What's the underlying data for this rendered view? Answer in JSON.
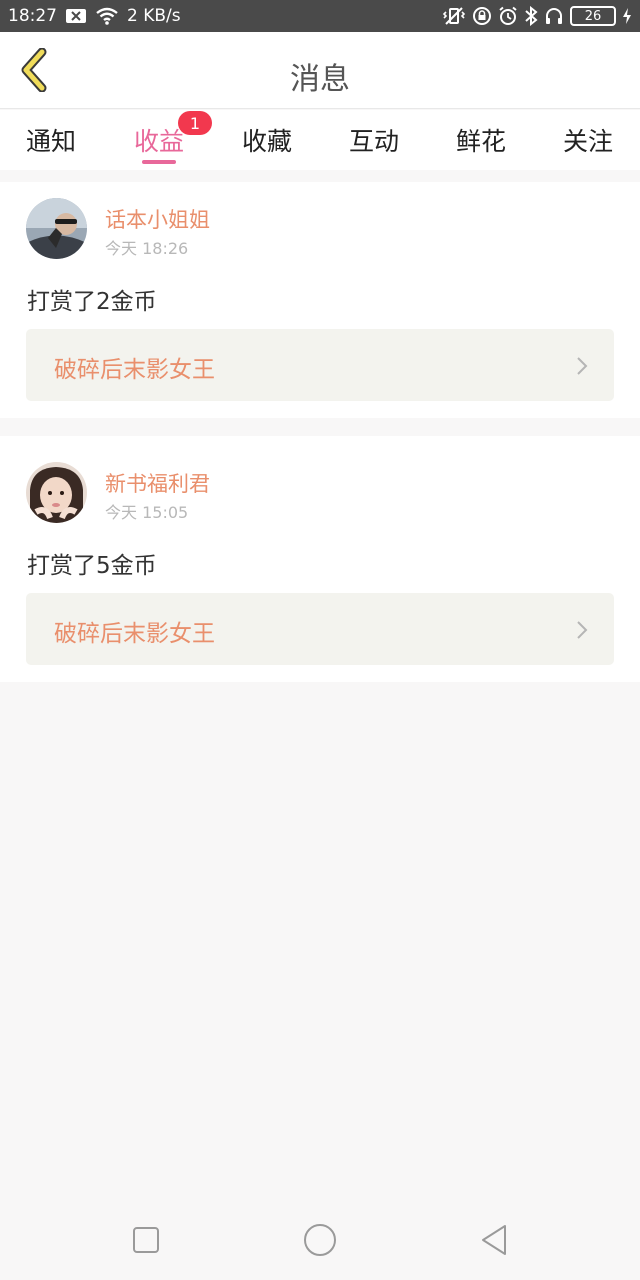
{
  "status_bar": {
    "time": "18:27",
    "network_speed": "2 KB/s",
    "battery_level": "26",
    "icons": [
      "notification-x-icon",
      "wifi-icon",
      "vibrate-icon",
      "lock-rotation-icon",
      "alarm-icon",
      "bluetooth-icon",
      "headphones-icon",
      "battery-icon",
      "charging-icon"
    ]
  },
  "header": {
    "title": "消息",
    "back_icon": "chevron-left-icon",
    "back_color": "#f0dc5a"
  },
  "tabs": [
    {
      "label": "通知",
      "active": false
    },
    {
      "label": "收益",
      "active": true,
      "badge": "1"
    },
    {
      "label": "收藏",
      "active": false
    },
    {
      "label": "互动",
      "active": false
    },
    {
      "label": "鲜花",
      "active": false
    },
    {
      "label": "关注",
      "active": false
    }
  ],
  "accent_color": "#e8689a",
  "messages": [
    {
      "sender": "话本小姐姐",
      "time": "今天 18:26",
      "text": "打赏了2金币",
      "book_title": "破碎后末影女王"
    },
    {
      "sender": "新书福利君",
      "time": "今天 15:05",
      "text": "打赏了5金币",
      "book_title": "破碎后末影女王"
    }
  ],
  "nav_bar": {
    "icons": [
      "recent-apps-square-icon",
      "home-circle-icon",
      "back-triangle-icon"
    ]
  }
}
